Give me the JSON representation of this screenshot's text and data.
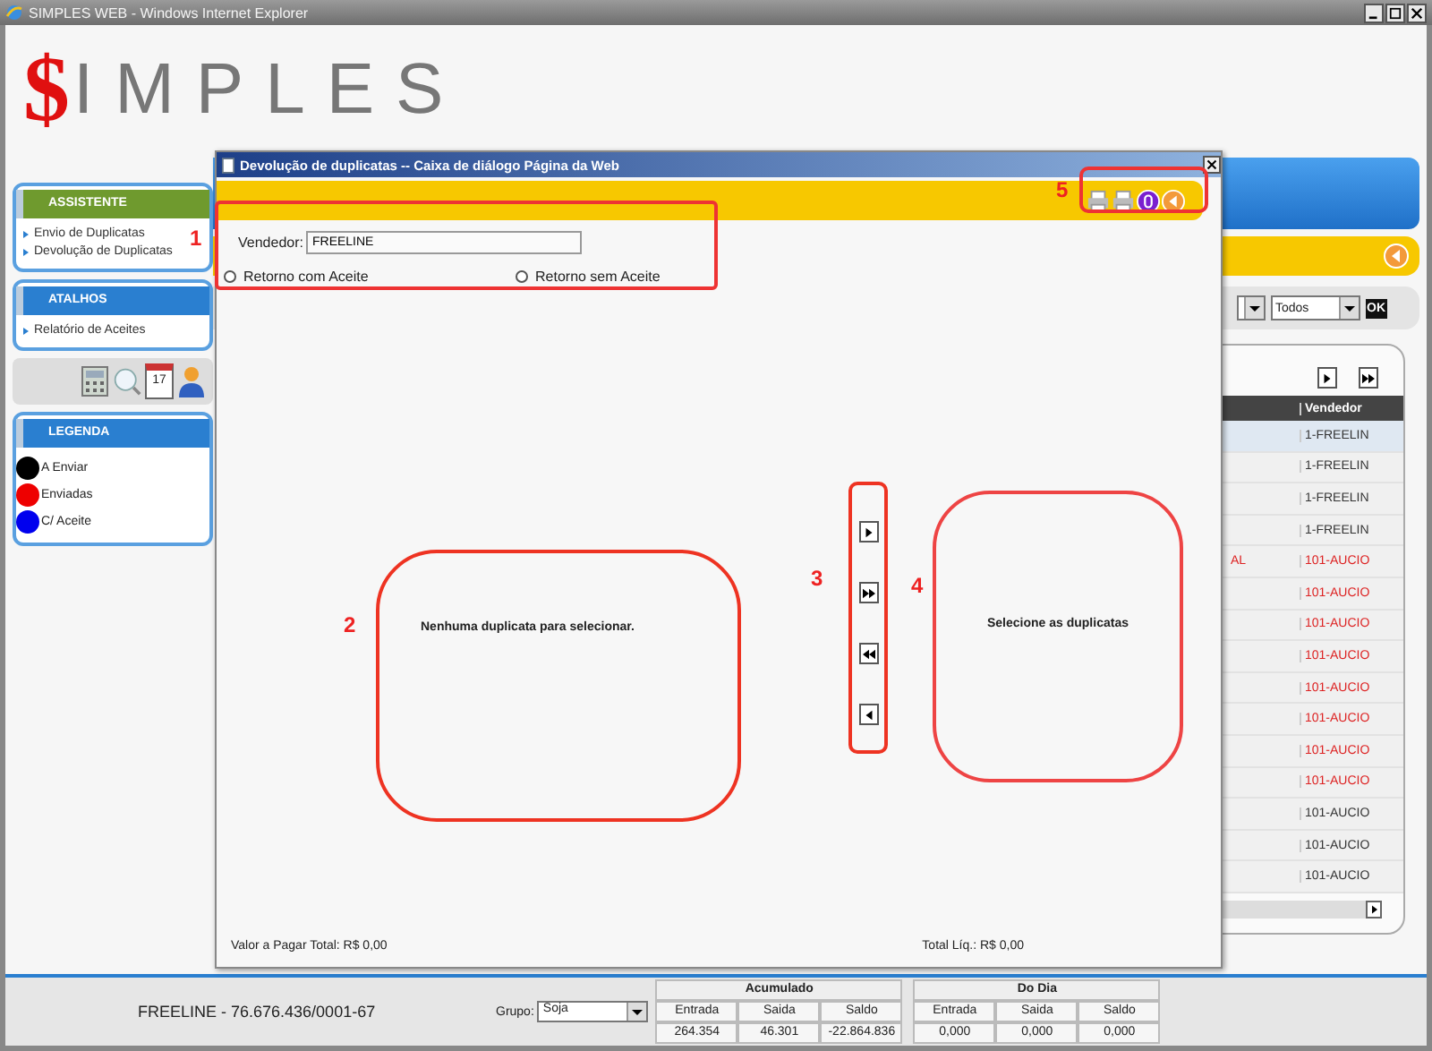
{
  "browser": {
    "title": "SIMPLES WEB - Windows Internet Explorer"
  },
  "logo": {
    "symbol": "$",
    "text": "IMPLES"
  },
  "sidebar": {
    "sections": [
      {
        "kind": "links",
        "title": "ASSISTENTE",
        "items": [
          {
            "label": "Envio de Duplicatas"
          },
          {
            "label": "Devolução de Duplicatas"
          }
        ]
      },
      {
        "kind": "links",
        "title": "ATALHOS",
        "items": [
          {
            "label": "Relatório de Aceites"
          }
        ]
      },
      {
        "kind": "tools",
        "calendar_day": "17"
      },
      {
        "kind": "legend",
        "title": "LEGENDA",
        "items": [
          {
            "label": "A Enviar",
            "color": "#000000"
          },
          {
            "label": "Enviadas",
            "color": "#ee0000"
          },
          {
            "label": "C/ Aceite",
            "color": "#0000ee"
          }
        ]
      }
    ]
  },
  "filters": {
    "status": "Todos",
    "ok_button": "OK"
  },
  "table": {
    "columns": [
      "Vendedor"
    ],
    "rows": [
      {
        "column_1": "",
        "vendedor": "1-FREELIN",
        "color": "#333333",
        "selected": true
      },
      {
        "column_1": "",
        "vendedor": "1-FREELIN",
        "color": "#333333",
        "selected": false
      },
      {
        "column_1": "",
        "vendedor": "1-FREELIN",
        "color": "#333333",
        "selected": false
      },
      {
        "column_1": "",
        "vendedor": "1-FREELIN",
        "color": "#333333",
        "selected": false
      },
      {
        "column_1": "AL",
        "vendedor": "101-AUCIO",
        "color": "#dd2222",
        "selected": false
      },
      {
        "column_1": "",
        "vendedor": "101-AUCIO",
        "color": "#dd2222",
        "selected": false
      },
      {
        "column_1": "",
        "vendedor": "101-AUCIO",
        "color": "#dd2222",
        "selected": false
      },
      {
        "column_1": "",
        "vendedor": "101-AUCIO",
        "color": "#dd2222",
        "selected": false
      },
      {
        "column_1": "",
        "vendedor": "101-AUCIO",
        "color": "#dd2222",
        "selected": false
      },
      {
        "column_1": "",
        "vendedor": "101-AUCIO",
        "color": "#dd2222",
        "selected": false
      },
      {
        "column_1": "",
        "vendedor": "101-AUCIO",
        "color": "#dd2222",
        "selected": false
      },
      {
        "column_1": "",
        "vendedor": "101-AUCIO",
        "color": "#dd2222",
        "selected": false
      },
      {
        "column_1": "",
        "vendedor": "101-AUCIO",
        "color": "#333333",
        "selected": false
      },
      {
        "column_1": "",
        "vendedor": "101-AUCIO",
        "color": "#333333",
        "selected": false
      },
      {
        "column_1": "",
        "vendedor": "101-AUCIO",
        "color": "#333333",
        "selected": false
      }
    ]
  },
  "status_bar": {
    "company": "FREELINE - 76.676.436/0001-67",
    "group_label": "Grupo:",
    "group_value": "Soja",
    "summaries": [
      {
        "title": "Acumulado",
        "headers": [
          "Entrada",
          "Saida",
          "Saldo"
        ],
        "values": [
          "264.354",
          "46.301",
          "-22.864.836"
        ]
      },
      {
        "title": "Do Dia",
        "headers": [
          "Entrada",
          "Saida",
          "Saldo"
        ],
        "values": [
          "0,000",
          "0,000",
          "0,000"
        ]
      }
    ]
  },
  "dialog": {
    "title": "Devolução de duplicatas -- Caixa de diálogo Página da Web",
    "vendor_label": "Vendedor:",
    "vendor_value": "FREELINE",
    "radios": [
      {
        "label": "Retorno com Aceite",
        "checked": false
      },
      {
        "label": "Retorno sem Aceite",
        "checked": false
      }
    ],
    "available_message": "Nenhuma duplicata para selecionar.",
    "transfer_buttons": [
      {
        "kind": "add-one"
      },
      {
        "kind": "add-all"
      },
      {
        "kind": "remove-all"
      },
      {
        "kind": "remove-one"
      }
    ],
    "selected_message": "Selecione as duplicatas",
    "total_to_pay": "Valor a Pagar Total: R$ 0,00",
    "net_total": "Total Líq.: R$ 0,00"
  },
  "annotations": [
    "1",
    "2",
    "3",
    "4",
    "5"
  ]
}
